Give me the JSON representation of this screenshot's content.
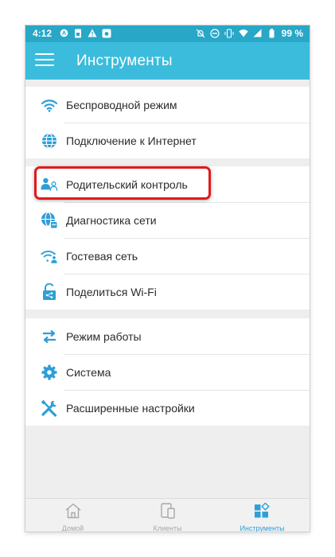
{
  "status_bar": {
    "time": "4:12",
    "battery": "99 %",
    "left_icons": [
      "a-circle-icon",
      "sim-icon",
      "warning-icon",
      "camera-icon"
    ],
    "right_icons": [
      "bell-off-icon",
      "dnd-icon",
      "vibrate-icon",
      "wifi-icon",
      "signal-icon",
      "battery-icon"
    ]
  },
  "app_bar": {
    "title": "Инструменты",
    "menu_icon": "hamburger-menu-icon"
  },
  "sections": [
    {
      "items": [
        {
          "label": "Беспроводной режим",
          "icon": "wifi-icon"
        },
        {
          "label": "Подключение к Интернет",
          "icon": "globe-icon"
        }
      ]
    },
    {
      "items": [
        {
          "label": "Родительский контроль",
          "icon": "parental-control-icon"
        },
        {
          "label": "Диагностика сети",
          "icon": "globe-diagnostic-icon"
        },
        {
          "label": "Гостевая сеть",
          "icon": "guest-wifi-icon"
        },
        {
          "label": "Поделиться Wi-Fi",
          "icon": "share-lock-icon"
        }
      ]
    },
    {
      "items": [
        {
          "label": "Режим работы",
          "icon": "swap-arrows-icon"
        },
        {
          "label": "Система",
          "icon": "gear-icon"
        },
        {
          "label": "Расширенные настройки",
          "icon": "tools-icon"
        }
      ]
    }
  ],
  "bottom_nav": {
    "tabs": [
      {
        "label": "Домой",
        "icon": "home-icon",
        "active": false
      },
      {
        "label": "Клиенты",
        "icon": "devices-icon",
        "active": false
      },
      {
        "label": "Инструменты",
        "icon": "tools-grid-icon",
        "active": true
      }
    ]
  },
  "colors": {
    "status_bar": "#28a7c7",
    "app_bar": "#3bbcdc",
    "icon": "#2e9fd6",
    "highlight": "#e0191b",
    "active_tab": "#2e9fd6",
    "inactive_tab": "#a8a8a8"
  }
}
